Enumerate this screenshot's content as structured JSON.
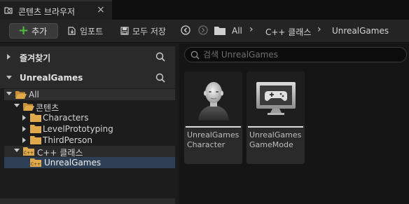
{
  "tab": {
    "title": "콘텐츠 브라우저",
    "close": "×"
  },
  "toolbar": {
    "add_label": "추가",
    "add_icon": "+",
    "import_label": "임포트",
    "save_all_label": "모두 저장"
  },
  "breadcrumb": [
    "All",
    "C++ 클래스",
    "UnrealGames"
  ],
  "breadcrumb_separator": "›",
  "sidebar": {
    "favorites_title": "즐겨찾기",
    "project_title": "UnrealGames",
    "tree": [
      {
        "label": "All",
        "expanded": true,
        "icon": "folder-open-icon"
      },
      {
        "label": "콘텐츠",
        "expanded": true,
        "icon": "folder-open-icon"
      },
      {
        "label": "Characters",
        "expanded": false,
        "icon": "folder-icon"
      },
      {
        "label": "LevelPrototyping",
        "expanded": false,
        "icon": "folder-icon"
      },
      {
        "label": "ThirdPerson",
        "expanded": false,
        "icon": "folder-icon"
      },
      {
        "label": "C++ 클래스",
        "expanded": true,
        "icon": "cpp-folder-icon"
      },
      {
        "label": "UnrealGames",
        "selected": true,
        "icon": "cpp-folder-icon"
      }
    ]
  },
  "search": {
    "placeholder": "검색 UnrealGames"
  },
  "assets": [
    {
      "line1": "UnrealGames",
      "line2": "Character",
      "icon": "character-icon"
    },
    {
      "line1": "UnrealGames",
      "line2": "GameMode",
      "icon": "gamemode-icon"
    }
  ],
  "colors": {
    "accent_green": "#4fbd3b",
    "folder_orange": "#e0a94a",
    "selected_row": "#2d3f55"
  }
}
